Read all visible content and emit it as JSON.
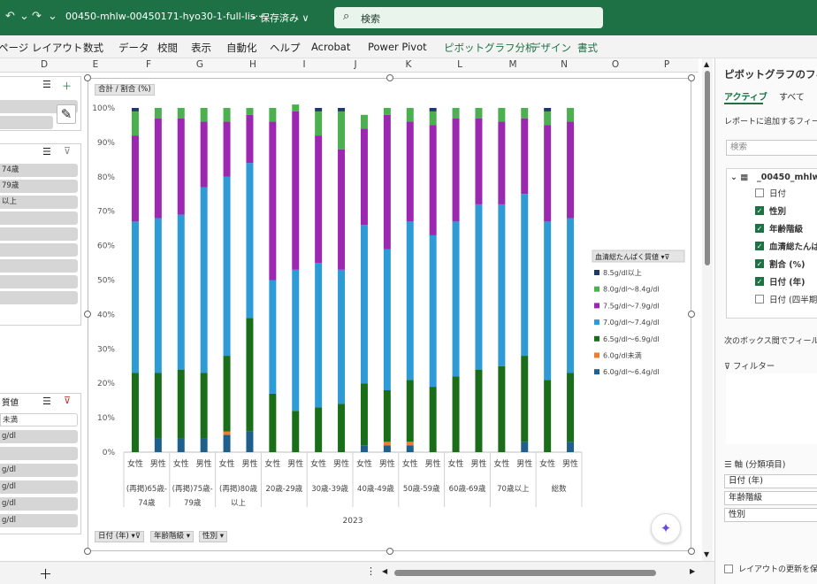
{
  "titlebar": {
    "filename": "00450-mhlw-00450171-hyo30-1-full-lis···",
    "saved": "• 保存済み ∨",
    "search_placeholder": "検索"
  },
  "ribbon": {
    "tabs": [
      "ページ レイアウト",
      "数式",
      "データ",
      "校閲",
      "表示",
      "自動化",
      "ヘルプ",
      "Acrobat",
      "Power Pivot",
      "ピボットグラフ分析",
      "デザイン",
      "書式"
    ]
  },
  "columns": [
    "D",
    "E",
    "F",
    "G",
    "H",
    "I",
    "J",
    "K",
    "L",
    "M",
    "N",
    "O",
    "P"
  ],
  "slicers": {
    "top_chips": [
      "",
      ""
    ],
    "age_chips": [
      "74歳",
      "79歳",
      "以上",
      "",
      "",
      "",
      "",
      "",
      ""
    ],
    "bottom_title": "質値",
    "bottom_chips": [
      "未満",
      "g/dl",
      "",
      "g/dl",
      "g/dl",
      "g/dl",
      "g/dl"
    ]
  },
  "chart": {
    "value_button": "合計 / 割合 (%)",
    "axis_buttons": [
      "日付 (年)",
      "年齢階級",
      "性別"
    ],
    "legend_title": "血清総たんぱく質値",
    "year": "2023",
    "sex_labels": [
      "女性",
      "男性"
    ],
    "group_labels": [
      "(再掲)65歳-74歳",
      "(再掲)75歳-79歳",
      "(再掲)80歳以上",
      "20歳-29歳",
      "30歳-39歳",
      "40歳-49歳",
      "50歳-59歳",
      "60歳-69歳",
      "70歳以上",
      "総数"
    ],
    "y_ticks": [
      "0%",
      "10%",
      "20%",
      "30%",
      "40%",
      "50%",
      "60%",
      "70%",
      "80%",
      "90%",
      "100%"
    ]
  },
  "chart_data": {
    "type": "bar",
    "stacked": true,
    "categories": [
      "(再掲)65歳-74歳 女性",
      "(再掲)65歳-74歳 男性",
      "(再掲)75歳-79歳 女性",
      "(再掲)75歳-79歳 男性",
      "(再掲)80歳以上 女性",
      "(再掲)80歳以上 男性",
      "20歳-29歳 女性",
      "20歳-29歳 男性",
      "30歳-39歳 女性",
      "30歳-39歳 男性",
      "40歳-49歳 女性",
      "40歳-49歳 男性",
      "50歳-59歳 女性",
      "50歳-59歳 男性",
      "60歳-69歳 女性",
      "60歳-69歳 男性",
      "70歳以上 女性",
      "70歳以上 男性",
      "総数 女性",
      "総数 男性"
    ],
    "series": [
      {
        "name": "6.0g/dl～6.4g/dl",
        "color": "#1f5f8b",
        "values": [
          0,
          4,
          4,
          4,
          5,
          6,
          0,
          0,
          0,
          0,
          2,
          2,
          2,
          0,
          0,
          0,
          0,
          3,
          0,
          3
        ]
      },
      {
        "name": "6.0g/dl未満",
        "color": "#ed7d31",
        "values": [
          0,
          0,
          0,
          0,
          1,
          0,
          0,
          0,
          0,
          0,
          0,
          1,
          1,
          0,
          0,
          0,
          0,
          0,
          0,
          0
        ]
      },
      {
        "name": "6.5g/dl～6.9g/dl",
        "color": "#1a6e1a",
        "values": [
          23,
          19,
          20,
          19,
          22,
          33,
          17,
          12,
          13,
          14,
          18,
          15,
          18,
          19,
          22,
          24,
          25,
          25,
          21,
          20
        ]
      },
      {
        "name": "7.0g/dl～7.4g/dl",
        "color": "#2e9bd6",
        "values": [
          44,
          45,
          45,
          54,
          52,
          45,
          33,
          41,
          42,
          39,
          46,
          41,
          46,
          44,
          45,
          48,
          47,
          47,
          46,
          45
        ]
      },
      {
        "name": "7.5g/dl～7.9g/dl",
        "color": "#9c27b0",
        "values": [
          25,
          29,
          28,
          19,
          16,
          14,
          46,
          46,
          37,
          35,
          28,
          39,
          29,
          32,
          30,
          25,
          24,
          22,
          28,
          28
        ]
      },
      {
        "name": "8.0g/dl～8.4g/dl",
        "color": "#4caf50",
        "values": [
          7,
          3,
          3,
          4,
          4,
          2,
          4,
          2,
          7,
          11,
          4,
          2,
          4,
          4,
          3,
          3,
          4,
          3,
          4,
          4
        ]
      },
      {
        "name": "8.5g/dl以上",
        "color": "#1f3864",
        "values": [
          1,
          0,
          0,
          0,
          0,
          0,
          0,
          0,
          1,
          1,
          0,
          0,
          0,
          1,
          0,
          0,
          0,
          0,
          1,
          0
        ]
      }
    ],
    "ylim": [
      0,
      100
    ],
    "yunit": "%",
    "legend_position": "right"
  },
  "panel": {
    "title": "ピボットグラフのフィー",
    "tabs": [
      "アクティブ",
      "すべて"
    ],
    "hint": "レポートに追加するフィール",
    "search_placeholder": "検索",
    "table": "_00450_mhlw",
    "fields": [
      {
        "label": "日付",
        "checked": false
      },
      {
        "label": "性別",
        "checked": true
      },
      {
        "label": "年齢階級",
        "checked": true
      },
      {
        "label": "血清総たんぱ",
        "checked": true
      },
      {
        "label": "割合 (%)",
        "checked": true
      },
      {
        "label": "日付 (年)",
        "checked": true
      },
      {
        "label": "日付 (四半期",
        "checked": false
      }
    ],
    "drag_hint": "次のボックス間でフィールド",
    "filter_label": "フィルター",
    "axis_label": "軸 (分類項目)",
    "axis_items": [
      "日付 (年)",
      "年齢階級",
      "性別"
    ],
    "defer": "レイアウトの更新を保"
  }
}
